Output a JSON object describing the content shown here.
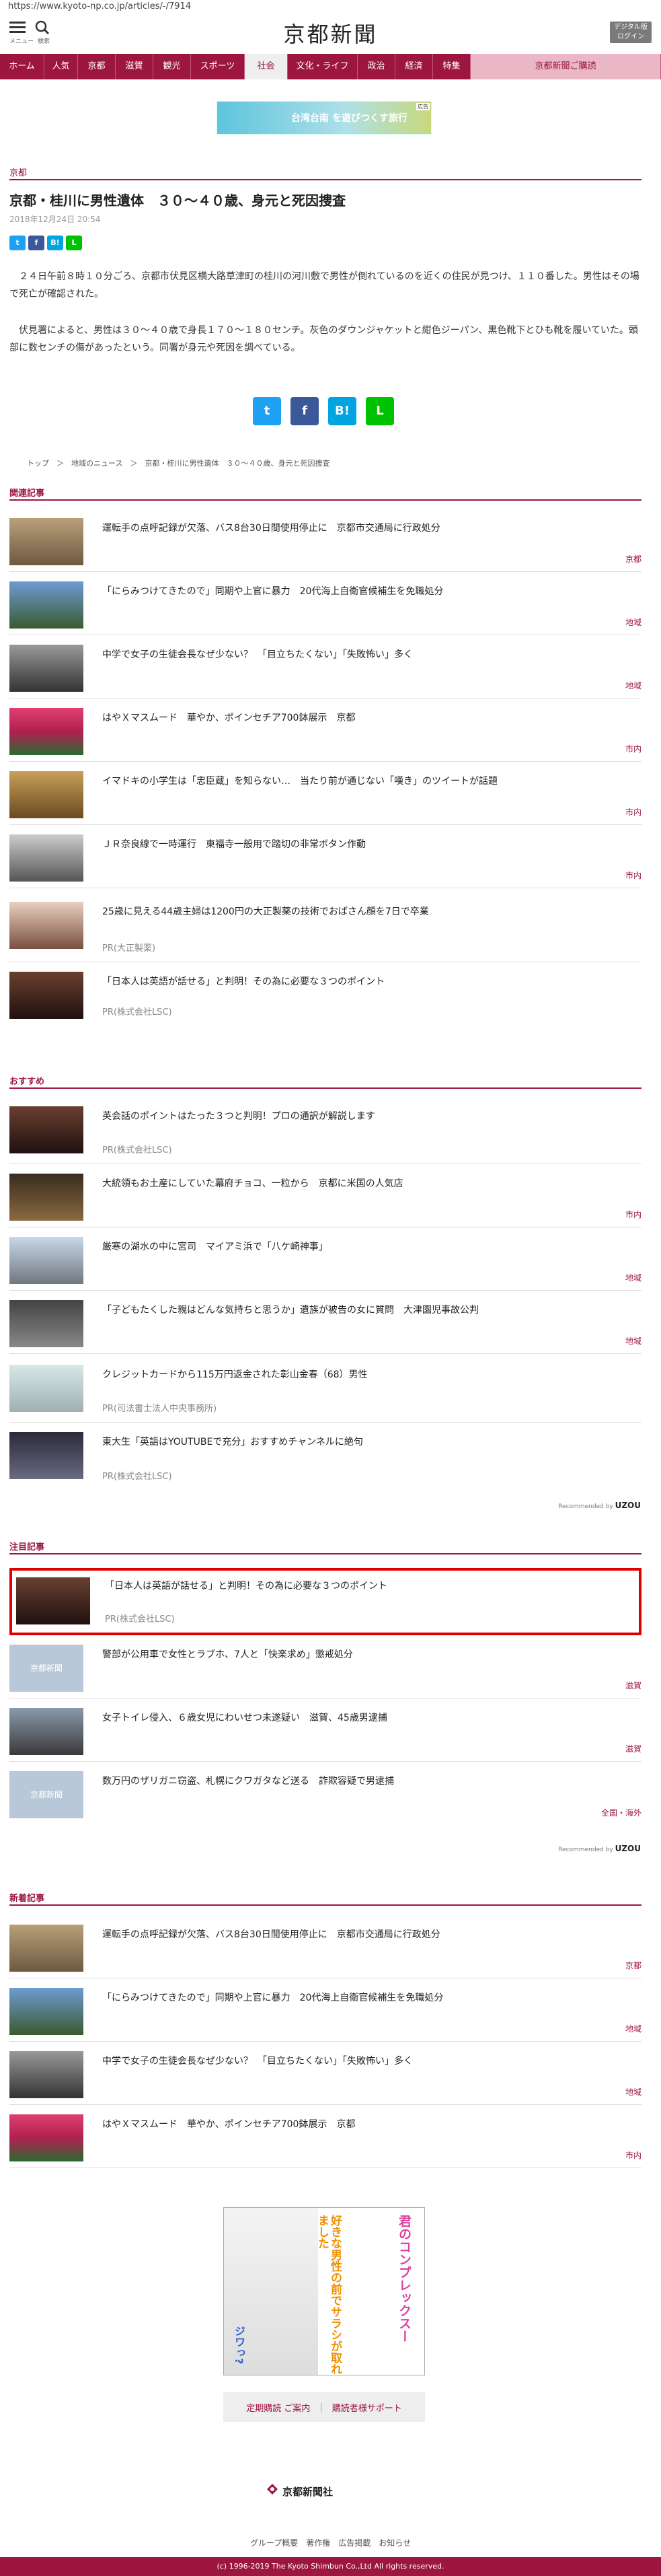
{
  "browser": {
    "url": "https://www.kyoto-np.co.jp/articles/-/7914"
  },
  "header": {
    "menu_label": "メニュー",
    "search_label": "検索",
    "logo": "京都新聞",
    "digital_line1": "デジタル版",
    "digital_line2": "ログイン"
  },
  "nav": [
    "ホーム",
    "人気",
    "京都",
    "滋賀",
    "観光",
    "スポーツ",
    "社会",
    "文化・ライフ",
    "政治",
    "経済",
    "特集",
    "京都新聞ご購読"
  ],
  "ad": {
    "tag": "広告",
    "text": "台湾台南 を遊びつくす旅行"
  },
  "article": {
    "category": "京都",
    "title": "京都・桂川に男性遺体　３０～４０歳、身元と死因捜査",
    "date": "2018年12月24日 20:54",
    "share_small": [
      "t",
      "f",
      "B!",
      "L"
    ],
    "para1": "　２４日午前８時１０分ごろ、京都市伏見区横大路草津町の桂川の河川敷で男性が倒れているのを近くの住民が見つけ、１１０番した。男性はその場で死亡が確認された。",
    "para2": "　伏見署によると、男性は３０～４０歳で身長１７０～１８０センチ。灰色のダウンジャケットと紺色ジーパン、黒色靴下とひも靴を履いていた。頭部に数センチの傷があったという。同署が身元や死因を調べている。",
    "share_big": [
      "t",
      "f",
      "B!",
      "L"
    ]
  },
  "breadcrumb": "トップ　＞　地域のニュース　＞　京都・桂川に男性遺体　３０～４０歳、身元と死因捜査",
  "related": {
    "heading": "関連記事",
    "items": [
      {
        "title": "運転手の点呼記録が欠落、バス8台30日間使用停止に　京都市交通局に行政処分",
        "tag": "京都"
      },
      {
        "title": "「にらみつけてきたので」同期や上官に暴力　20代海上自衛官候補生を免職処分",
        "tag": "地域"
      },
      {
        "title": "中学で女子の生徒会長なぜ少ない？　「目立ちたくない」「失敗怖い」多く",
        "tag": "地域"
      },
      {
        "title": "はやＸマスムード　華やか、ポインセチア700鉢展示　京都",
        "tag": "市内"
      },
      {
        "title": "イマドキの小学生は「忠臣蔵」を知らない…　当たり前が通じない「嘆き」のツイートが話題",
        "tag": "市内"
      },
      {
        "title": "ＪＲ奈良線で一時運行　東福寺一般用で踏切の非常ボタン作動",
        "tag": "市内"
      },
      {
        "title": "25歳に見える44歳主婦は1200円の大正製薬の技術でおばさん顔を7日で卒業",
        "pr": "PR(大正製薬)"
      },
      {
        "title": "「日本人は英語が話せる」と判明！その為に必要な３つのポイント",
        "pr": "PR(株式会社LSC)"
      }
    ]
  },
  "recommend": {
    "heading": "おすすめ",
    "items": [
      {
        "title": "英会話のポイントはたった３つと判明！プロの通訳が解説します",
        "pr": "PR(株式会社LSC)"
      },
      {
        "title": "大統領もお土産にしていた幕府チョコ、一粒から　京都に米国の人気店",
        "tag": "市内"
      },
      {
        "title": "厳寒の湖水の中に宮司　マイアミ浜で「八ケ崎神事」",
        "tag": "地域"
      },
      {
        "title": "「子どもたくした親はどんな気持ちと思うか」遺族が被告の女に質問　大津園児事故公判",
        "tag": "地域"
      },
      {
        "title": "クレジットカードから115万円返金された彰山金春（68）男性",
        "pr": "PR(司法書士法人中央事務所)"
      },
      {
        "title": "東大生「英語はYOUTUBEで充分」おすすめチャンネルに絶句",
        "pr": "PR(株式会社LSC)"
      }
    ],
    "credit_label": "Recommended by",
    "credit_brand": "UZOU"
  },
  "featured": {
    "heading": "注目記事",
    "items": [
      {
        "title": "「日本人は英語が話せる」と判明！その為に必要な３つのポイント",
        "pr": "PR(株式会社LSC)"
      },
      {
        "title": "警部が公用車で女性とラブホ、7人と「快楽求め」懲戒処分",
        "tag": "滋賀",
        "thumb_text": "京都新聞"
      },
      {
        "title": "女子トイレ侵入、６歳女児にわいせつ未遂疑い　滋賀、45歳男逮捕",
        "tag": "滋賀"
      },
      {
        "title": "数万円のザリガニ窃盗、札幌にクワガタなど送る　詐欺容疑で男逮捕",
        "tag": "全国・海外",
        "thumb_text": "京都新聞"
      }
    ],
    "credit_label": "Recommended by",
    "credit_brand": "UZOU"
  },
  "latest": {
    "heading": "新着記事",
    "items": [
      {
        "title": "運転手の点呼記録が欠落、バス8台30日間使用停止に　京都市交通局に行政処分",
        "tag": "京都"
      },
      {
        "title": "「にらみつけてきたので」同期や上官に暴力　20代海上自衛官候補生を免職処分",
        "tag": "地域"
      },
      {
        "title": "中学で女子の生徒会長なぜ少ない？　「目立ちたくない」「失敗怖い」多く",
        "tag": "地域"
      },
      {
        "title": "はやＸマスムード　華やか、ポインセチア700鉢展示　京都",
        "tag": "市内"
      }
    ]
  },
  "manga_ad": {
    "text1": "好きな男性の前でサラシが取れました",
    "text2": "君のコンプレックスー",
    "text3": "ジワっ?"
  },
  "services": {
    "a": "定期購読 ご案内",
    "b": "購読者様サポート"
  },
  "footer": {
    "brand": "京都新聞社",
    "links": "グループ概要　著作権　広告掲載　お知らせ",
    "copyright": "(c) 1996-2019 The Kyoto Shimbun Co.,Ltd All rights reserved."
  },
  "colors": {
    "brand": "#9c1640",
    "highlight": "#e00000"
  }
}
